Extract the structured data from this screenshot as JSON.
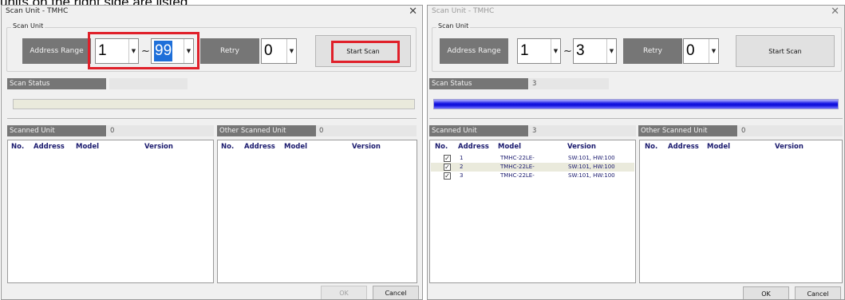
{
  "caption": "units on the right side are listed",
  "left": {
    "title": "Scan Unit - TMHC",
    "group_label": "Scan Unit",
    "address_range_label": "Address Range",
    "range_start": "1",
    "range_sep": "~",
    "range_end": "99",
    "retry_label": "Retry",
    "retry_value": "0",
    "start_scan_label": "Start Scan",
    "scan_status_label": "Scan Status",
    "scan_status_value": "",
    "progress": 0,
    "scanned_unit_label": "Scanned Unit",
    "scanned_unit_count": "0",
    "other_scanned_unit_label": "Other Scanned Unit",
    "other_scanned_unit_count": "0",
    "columns": [
      "No.",
      "Address",
      "Model",
      "Version"
    ],
    "rows": [],
    "ok_label": "OK",
    "cancel_label": "Cancel"
  },
  "right": {
    "title": "Scan Unit - TMHC",
    "group_label": "Scan Unit",
    "address_range_label": "Address Range",
    "range_start": "1",
    "range_sep": "~",
    "range_end": "3",
    "retry_label": "Retry",
    "retry_value": "0",
    "start_scan_label": "Start Scan",
    "scan_status_label": "Scan Status",
    "scan_status_value": "3",
    "progress": 1.0,
    "scanned_unit_label": "Scanned Unit",
    "scanned_unit_count": "3",
    "other_scanned_unit_label": "Other Scanned Unit",
    "other_scanned_unit_count": "0",
    "columns": [
      "No.",
      "Address",
      "Model",
      "Version"
    ],
    "rows": [
      {
        "checked": true,
        "address": "1",
        "model": "TMHC-22LE-",
        "version": "SW:101, HW:100"
      },
      {
        "checked": true,
        "address": "2",
        "model": "TMHC-22LE-",
        "version": "SW:101, HW:100"
      },
      {
        "checked": true,
        "address": "3",
        "model": "TMHC-22LE-",
        "version": "SW:101, HW:100"
      }
    ],
    "ok_label": "OK",
    "cancel_label": "Cancel"
  },
  "icons": {
    "close": "close-icon",
    "dropdown": "chevron-down-icon",
    "checkbox": "checkbox-checked-icon"
  },
  "colors": {
    "label_bg": "#767676",
    "highlight": "#e0202a",
    "progress_fill": "#0a0ad8",
    "list_text": "#1a1a6e"
  }
}
